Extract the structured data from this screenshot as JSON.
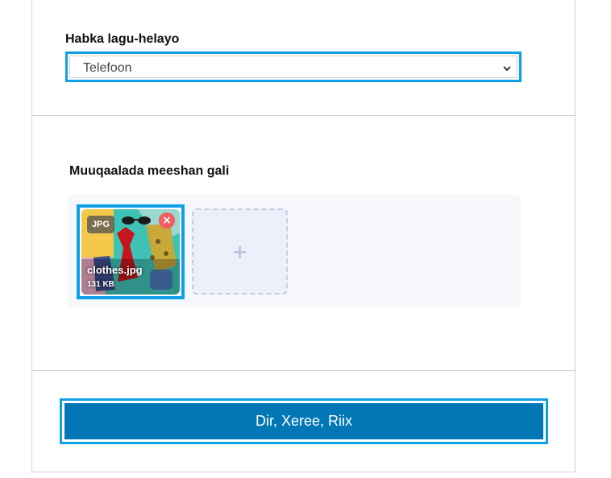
{
  "category": {
    "label": "Habka lagu-helayo",
    "selected": "Telefoon"
  },
  "media": {
    "label": "Muuqaalada meeshan gali",
    "files": [
      {
        "type_badge": "JPG",
        "name": "clothes.jpg",
        "size": "131 KB",
        "remove_icon": "×"
      }
    ],
    "add_icon": "+"
  },
  "submit": {
    "label": "Dir, Xeree, Riix"
  },
  "colors": {
    "accent_outline": "#0ea0e6",
    "button_bg": "#0277b6",
    "remove_bg": "#ef5d5d"
  },
  "icons": {
    "select": "chevron-down-icon",
    "remove": "close-icon",
    "add": "plus-icon"
  }
}
